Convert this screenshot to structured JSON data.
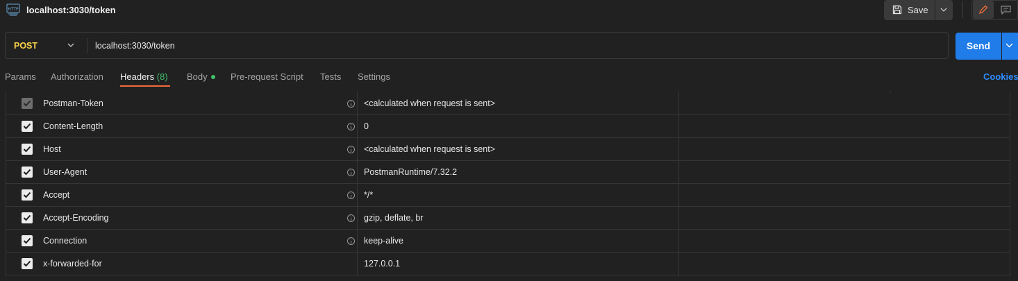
{
  "title": "localhost:3030/token",
  "toolbar": {
    "save_label": "Save"
  },
  "request": {
    "method": "POST",
    "url": "localhost:3030/token",
    "send_label": "Send"
  },
  "tabs": [
    {
      "label": "Params"
    },
    {
      "label": "Authorization"
    },
    {
      "label": "Headers",
      "count": "(8)",
      "active": true
    },
    {
      "label": "Body",
      "indicator": true
    },
    {
      "label": "Pre-request Script"
    },
    {
      "label": "Tests"
    },
    {
      "label": "Settings"
    }
  ],
  "cookies_label": "Cookies",
  "headers": [
    {
      "key": "Postman-Token",
      "value": "<calculated when request is sent>",
      "checked": true,
      "disabled": true,
      "info": true
    },
    {
      "key": "Content-Length",
      "value": "0",
      "checked": true,
      "info": true
    },
    {
      "key": "Host",
      "value": "<calculated when request is sent>",
      "checked": true,
      "info": true
    },
    {
      "key": "User-Agent",
      "value": "PostmanRuntime/7.32.2",
      "checked": true,
      "info": true
    },
    {
      "key": "Accept",
      "value": "*/*",
      "checked": true,
      "info": true
    },
    {
      "key": "Accept-Encoding",
      "value": "gzip, deflate, br",
      "checked": true,
      "info": true
    },
    {
      "key": "Connection",
      "value": "keep-alive",
      "checked": true,
      "info": true
    },
    {
      "key": "x-forwarded-for",
      "value": "127.0.0.1",
      "checked": true,
      "info": false
    }
  ],
  "colors": {
    "accent": "#1f7ce8",
    "method": "#ffd54a",
    "active_tab": "#f26b3a",
    "count": "#43c16a",
    "link": "#2f8cff"
  },
  "icons": [
    "http-icon",
    "save-icon",
    "chevron-down-icon",
    "edit-icon",
    "comment-icon",
    "checkbox-icon",
    "info-icon"
  ]
}
